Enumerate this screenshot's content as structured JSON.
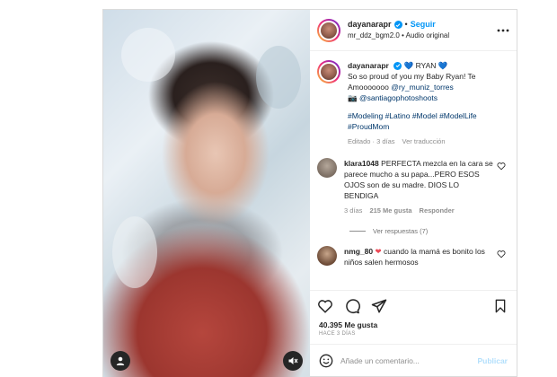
{
  "header": {
    "username": "dayanarapr",
    "follow_label": "Seguir",
    "dot": "•",
    "audio_user": "mr_ddz_bgm2.0",
    "audio_label": "Audio original"
  },
  "caption": {
    "username": "dayanarapr",
    "line1": "RYAN",
    "line2_prefix": "So so proud of you my Baby Ryan! Te Amooooooo",
    "mention1": "@ry_muniz_torres",
    "mention2": "@santiagophotoshoots",
    "hashtags": "#Modeling #Latino #Model #ModelLife #ProudMom",
    "edited": "Editado · 3 días",
    "translate": "Ver traducción"
  },
  "comments": [
    {
      "username": "klara1048",
      "text": "PERFECTA mezcla en la cara se parece mucho a su papa...PERO ESOS OJOS son de su madre. DIOS LO BENDIGA",
      "time": "3 días",
      "likes": "215 Me gusta",
      "reply": "Responder",
      "view_replies": "Ver respuestas (7)"
    },
    {
      "username": "nmg_80",
      "text": "cuando la mamá es bonito los niños salen hermosos"
    }
  ],
  "likes_count": "40.395 Me gusta",
  "post_date": "HACE 3 DÍAS",
  "composer": {
    "placeholder": "Añade un comentario...",
    "publish_label": "Publicar"
  },
  "colors": {
    "accent": "#0095f6",
    "verified": "#0095f6",
    "heart_blue": "#1877f2",
    "heart_red": "#ed4956"
  },
  "icons": {
    "verified": "verified-badge-icon",
    "more": "more-options-icon",
    "like": "heart-icon",
    "comment": "comment-icon",
    "share": "share-icon",
    "save": "bookmark-icon",
    "emoji": "emoji-icon",
    "user_tags": "user-tag-icon",
    "audio": "muted-audio-icon"
  }
}
